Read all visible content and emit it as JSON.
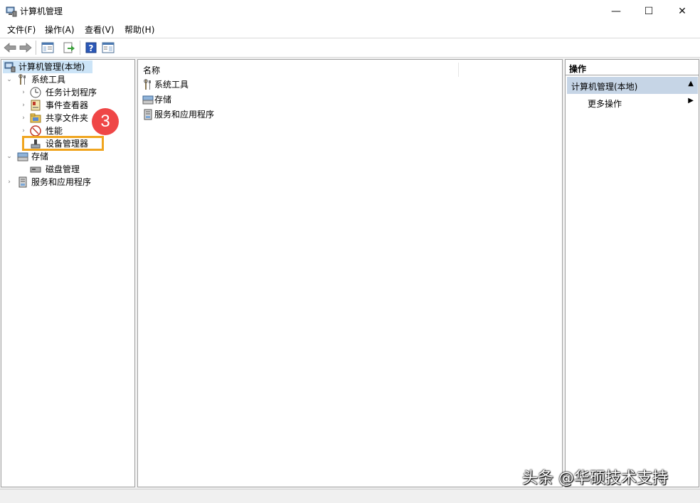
{
  "window": {
    "title": "计算机管理",
    "controls": {
      "minimize": "—",
      "maximize": "☐",
      "close": "✕"
    }
  },
  "menu": [
    "文件(F)",
    "操作(A)",
    "查看(V)",
    "帮助(H)"
  ],
  "toolbar": {
    "icons": [
      "back-arrow-icon",
      "forward-arrow-icon",
      "show-hide-tree-icon",
      "export-list-icon",
      "help-icon",
      "properties-icon"
    ]
  },
  "tree": {
    "root": "计算机管理(本地)",
    "system_tools": "系统工具",
    "task_scheduler": "任务计划程序",
    "event_viewer": "事件查看器",
    "shared_folders": "共享文件夹",
    "performance": "性能",
    "device_manager": "设备管理器",
    "storage": "存储",
    "disk_management": "磁盘管理",
    "services_apps": "服务和应用程序"
  },
  "list": {
    "header_name": "名称",
    "rows": [
      "系统工具",
      "存储",
      "服务和应用程序"
    ]
  },
  "actions": {
    "header": "操作",
    "section": "计算机管理(本地)",
    "more": "更多操作"
  },
  "annotation": {
    "step": "3"
  },
  "watermark": "头条 @华硕技术支持",
  "colors": {
    "highlight": "#f0a51f",
    "badge": "#ef4646",
    "selection": "#cce4f7",
    "action_header": "#c6d5e6"
  }
}
